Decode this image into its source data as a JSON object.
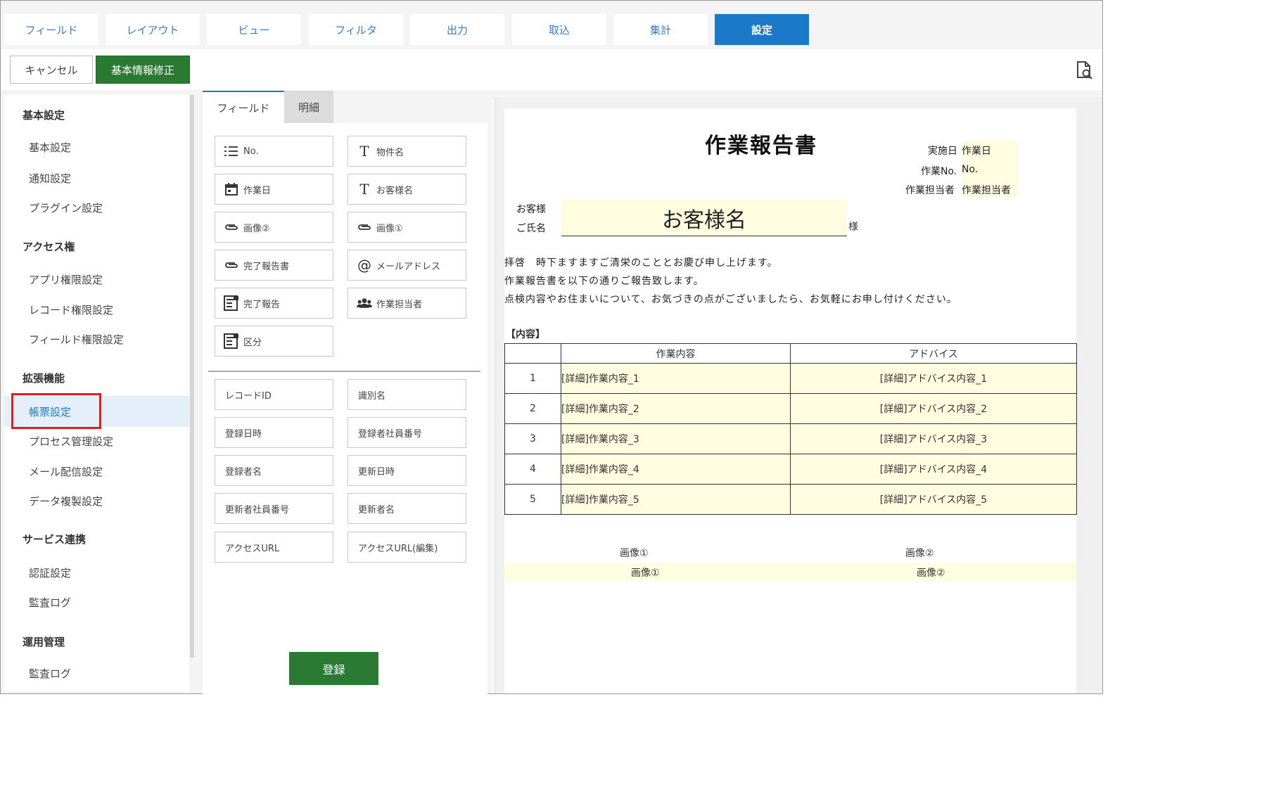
{
  "top_tabs": [
    "フィールド",
    "レイアウト",
    "ビュー",
    "フィルタ",
    "出力",
    "取込",
    "集計",
    "設定"
  ],
  "active_tab_index": 7,
  "toolbar": {
    "cancel": "キャンセル",
    "edit_basic": "基本情報修正",
    "preview_icon": "document-search-icon"
  },
  "sidebar": {
    "sections": [
      {
        "title": "基本設定",
        "items": [
          "基本設定",
          "通知設定",
          "プラグイン設定"
        ]
      },
      {
        "title": "アクセス権",
        "items": [
          "アプリ権限設定",
          "レコード権限設定",
          "フィールド権限設定"
        ]
      },
      {
        "title": "拡張機能",
        "items": [
          "帳票設定",
          "プロセス管理設定",
          "メール配信設定",
          "データ複製設定"
        ]
      },
      {
        "title": "サービス連携",
        "items": [
          "認証設定",
          "監査ログ"
        ]
      },
      {
        "title": "運用管理",
        "items": [
          "監査ログ"
        ]
      }
    ],
    "active_item": "帳票設定"
  },
  "mid_tabs": {
    "field": "フィールド",
    "detail": "明細"
  },
  "fields": [
    {
      "label": "No.",
      "icon": "list-number-icon"
    },
    {
      "label": "物件名",
      "icon": "text-icon"
    },
    {
      "label": "作業日",
      "icon": "calendar-icon"
    },
    {
      "label": "お客様名",
      "icon": "text-icon"
    },
    {
      "label": "画像②",
      "icon": "attachment-icon"
    },
    {
      "label": "画像①",
      "icon": "attachment-icon"
    },
    {
      "label": "完了報告書",
      "icon": "attachment-icon"
    },
    {
      "label": "メールアドレス",
      "icon": "at-icon"
    },
    {
      "label": "完了報告",
      "icon": "dropdown-field-icon"
    },
    {
      "label": "作業担当者",
      "icon": "users-icon"
    },
    {
      "label": "区分",
      "icon": "dropdown-field-icon"
    }
  ],
  "system_fields": [
    "レコードID",
    "識別名",
    "登録日時",
    "登録者社員番号",
    "登録者名",
    "更新日時",
    "更新者社員番号",
    "更新者名",
    "アクセスURL",
    "アクセスURL(編集)"
  ],
  "register_button": "登録",
  "doc": {
    "title": "作業報告書",
    "meta": {
      "date_label": "実施日",
      "date_value": "作業日",
      "no_label": "作業No.",
      "no_value": "No.",
      "staff_label": "作業担当者",
      "staff_value": "作業担当者"
    },
    "customer_label_1": "お客様",
    "customer_label_2": "ご氏名",
    "customer_value": "お客様名",
    "sama": "様",
    "greeting": [
      "拝啓　時下ますますご清栄のこととお慶び申し上げます。",
      "作業報告書を以下の通りご報告致します。",
      "点検内容やお住まいについて、お気づきの点がございましたら、お気軽にお申し付けください。"
    ],
    "section": "【内容】",
    "table_headers": [
      "",
      "作業内容",
      "アドバイス"
    ],
    "rows": [
      [
        "1",
        "[詳細]作業内容_1",
        "[詳細]アドバイス内容_1"
      ],
      [
        "2",
        "[詳細]作業内容_2",
        "[詳細]アドバイス内容_2"
      ],
      [
        "3",
        "[詳細]作業内容_3",
        "[詳細]アドバイス内容_3"
      ],
      [
        "4",
        "[詳細]作業内容_4",
        "[詳細]アドバイス内容_4"
      ],
      [
        "5",
        "[詳細]作業内容_5",
        "[詳細]アドバイス内容_5"
      ]
    ],
    "image_labels": [
      "画像①",
      "画像②"
    ],
    "image_values": [
      "画像①",
      "画像②"
    ]
  }
}
